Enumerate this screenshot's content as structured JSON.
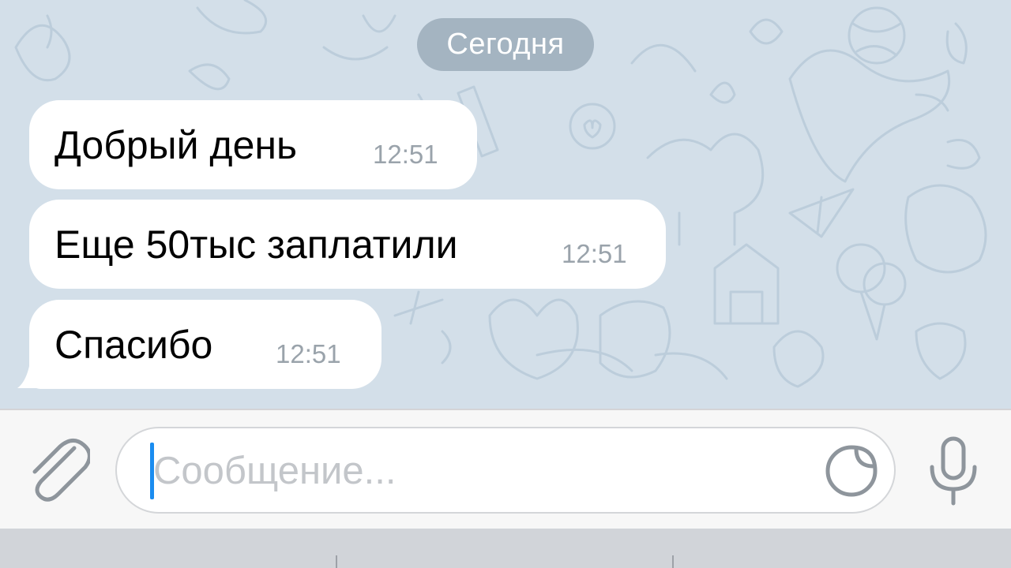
{
  "date_separator": "Сегодня",
  "messages": [
    {
      "text": "Добрый день",
      "time": "12:51"
    },
    {
      "text": "Еще 50тыс заплатили",
      "time": "12:51"
    },
    {
      "text": "Спасибо",
      "time": "12:51"
    }
  ],
  "composer": {
    "placeholder": "Сообщение..."
  },
  "icons": {
    "attach": "paperclip-icon",
    "sticker": "sticker-icon",
    "voice": "microphone-icon"
  },
  "colors": {
    "chat_background": "#d3dfe9",
    "bubble": "#ffffff",
    "cursor": "#1a8cf0",
    "timestamp": "#9aa3ab"
  }
}
